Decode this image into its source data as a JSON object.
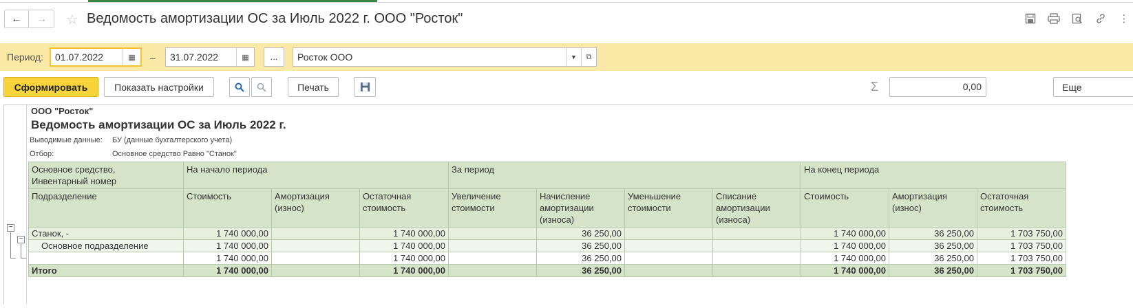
{
  "window": {
    "title": "Ведомость амортизации ОС за Июль 2022 г. ООО \"Росток\"",
    "nav_back": "←",
    "nav_forward": "→",
    "favorite_icon": "star-icon",
    "icons": [
      "save-icon",
      "print-icon",
      "preview-icon",
      "link-icon",
      "more-icon"
    ]
  },
  "filters": {
    "period_label": "Период:",
    "date_from": "01.07.2022",
    "dash": "–",
    "date_to": "31.07.2022",
    "dots_label": "...",
    "organization": "Росток ООО"
  },
  "toolbar": {
    "form_label": "Сформировать",
    "settings_label": "Показать настройки",
    "print_label": "Печать",
    "sum_value": "0,00",
    "more_label": "Еще"
  },
  "report": {
    "org": "ООО \"Росток\"",
    "title": "Ведомость амортизации ОС за Июль 2022 г.",
    "output_label": "Выводимые данные:",
    "output_value": "БУ (данные бухгалтерского учета)",
    "filter_label": "Отбор:",
    "filter_value": "Основное средство Равно \"Станок\"",
    "header": {
      "col1_line1": "Основное средство,",
      "col1_line2": "Инвентарный номер",
      "col1_sub": "Подразделение",
      "group_start": "На начало периода",
      "group_period": "За период",
      "group_end": "На конец периода",
      "cols": [
        "Стоимость",
        "Амортизация (износ)",
        "Остаточная стоимость",
        "Увеличение стоимости",
        "Начисление амортизации (износа)",
        "Уменьшение стоимости",
        "Списание амортизации (износа)",
        "Стоимость",
        "Амортизация (износ)",
        "Остаточная стоимость"
      ]
    },
    "rows": [
      {
        "name": "Станок, -",
        "cells": [
          "1 740 000,00",
          "",
          "1 740 000,00",
          "",
          "36 250,00",
          "",
          "",
          "1 740 000,00",
          "36 250,00",
          "1 703 750,00"
        ]
      },
      {
        "name": "Основное подразделение",
        "cells": [
          "1 740 000,00",
          "",
          "1 740 000,00",
          "",
          "36 250,00",
          "",
          "",
          "1 740 000,00",
          "36 250,00",
          "1 703 750,00"
        ]
      },
      {
        "name": "",
        "cells": [
          "1 740 000,00",
          "",
          "1 740 000,00",
          "",
          "36 250,00",
          "",
          "",
          "1 740 000,00",
          "36 250,00",
          "1 703 750,00"
        ]
      }
    ],
    "total": {
      "name": "Итого",
      "cells": [
        "1 740 000,00",
        "",
        "1 740 000,00",
        "",
        "36 250,00",
        "",
        "",
        "1 740 000,00",
        "36 250,00",
        "1 703 750,00"
      ]
    }
  }
}
